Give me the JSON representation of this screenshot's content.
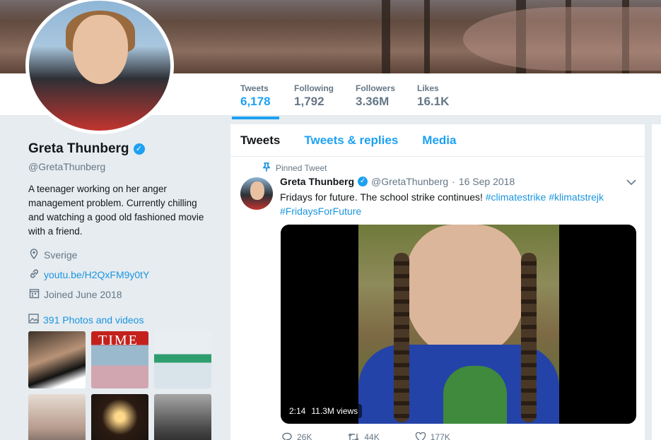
{
  "profile": {
    "name": "Greta Thunberg",
    "handle": "@GretaThunberg",
    "bio": "A teenager working on her anger management problem. Currently chilling and watching a good old fashioned movie with a friend.",
    "location": "Sverige",
    "link": "youtu.be/H2QxFM9y0tY",
    "joined": "Joined June 2018",
    "photos_label": "391 Photos and videos",
    "verified_glyph": "✓"
  },
  "stats": [
    {
      "label": "Tweets",
      "value": "6,178"
    },
    {
      "label": "Following",
      "value": "1,792"
    },
    {
      "label": "Followers",
      "value": "3.36M"
    },
    {
      "label": "Likes",
      "value": "16.1K"
    }
  ],
  "tabs": [
    "Tweets",
    "Tweets & replies",
    "Media"
  ],
  "tweet": {
    "pinned_label": "Pinned Tweet",
    "author": "Greta Thunberg",
    "handle": "@GretaThunberg",
    "sep": "·",
    "date": "16 Sep 2018",
    "text": "Fridays for future. The school strike continues!",
    "hashtags": [
      "#climatestrike",
      "#klimatstrejk",
      "#FridaysForFuture"
    ],
    "video_duration": "2:14",
    "video_views": "11.3M views",
    "reply_count": "26K",
    "retweet_count": "44K",
    "like_count": "177K"
  },
  "thumb_time_text": "TIME",
  "icons": {
    "location": "location-pin-icon",
    "link": "link-icon",
    "calendar": "calendar-icon",
    "photos": "image-icon",
    "pin": "pin-icon",
    "chevron": "chevron-down-icon"
  },
  "colors": {
    "accent": "#1da1f2",
    "link": "#1b95e0",
    "muted": "#657786"
  }
}
